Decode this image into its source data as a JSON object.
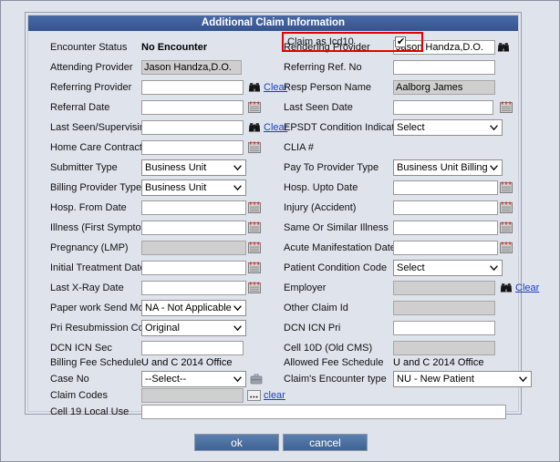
{
  "panel": {
    "title": "Additional Claim Information"
  },
  "icd10": {
    "label": "Claim as Icd10",
    "checked": true,
    "tick": "✔",
    "highlight_color": "#e60000"
  },
  "icons": {
    "binoculars": "binoculars-icon",
    "calendar": "calendar-icon",
    "briefcase": "briefcase-icon",
    "ellipsis": "ellipsis-button-icon"
  },
  "links": {
    "clear_cap": "Clear",
    "clear_low": "clear"
  },
  "left": [
    {
      "label": "Encounter Status",
      "type": "static",
      "value": "No Encounter",
      "bold": true
    },
    {
      "label": "Attending Provider",
      "type": "readonly",
      "value": "Jason Handza,D.O."
    },
    {
      "label": "Referring Provider",
      "type": "input",
      "value": "",
      "icon": "binoculars",
      "link": "Clear"
    },
    {
      "label": "Referral Date",
      "type": "input",
      "value": "",
      "icon": "calendar"
    },
    {
      "label": "Last Seen/Supervising Doc",
      "type": "input",
      "value": "",
      "icon": "binoculars",
      "link": "Clear"
    },
    {
      "label": "Home Care Contract Date",
      "type": "input",
      "value": "",
      "icon": "calendar"
    },
    {
      "label": "Submitter Type",
      "type": "select",
      "value": "Business Unit"
    },
    {
      "label": "Billing Provider Type",
      "type": "select",
      "value": "Business Unit"
    },
    {
      "label": "Hosp. From Date",
      "type": "input",
      "value": "",
      "icon": "calendar"
    },
    {
      "label": "Illness (First Symptom)",
      "type": "input",
      "value": "",
      "icon": "calendar"
    },
    {
      "label": "Pregnancy (LMP)",
      "type": "readonly",
      "value": "",
      "icon": "calendar"
    },
    {
      "label": "Initial Treatment Date",
      "type": "input",
      "value": "",
      "icon": "calendar"
    },
    {
      "label": "Last X-Ray Date",
      "type": "input",
      "value": "",
      "icon": "calendar"
    },
    {
      "label": "Paper work Send Mode",
      "type": "select",
      "value": "NA - Not Applicable"
    },
    {
      "label": "Pri Resubmission Code",
      "type": "select",
      "value": "Original"
    },
    {
      "label": "DCN ICN Sec",
      "type": "input",
      "value": ""
    },
    {
      "label": "Billing Fee Schedule",
      "type": "static",
      "value": "U and C 2014 Office",
      "bold": false
    },
    {
      "label": "Case No",
      "type": "select",
      "value": "--Select--",
      "icon": "briefcase"
    },
    {
      "label": "Claim Codes",
      "type": "readonly",
      "value": "",
      "icon": "ellipsis",
      "link": "clear"
    },
    {
      "label": "Cell 19 Local Use",
      "type": "input",
      "value": ""
    }
  ],
  "right": [
    {
      "label": "Rendering Provider",
      "type": "input",
      "value": "Jason Handza,D.O.",
      "icon": "binoculars"
    },
    {
      "label": "Referring Ref. No",
      "type": "input",
      "value": ""
    },
    {
      "label": "Resp Person Name",
      "type": "readonly",
      "value": "Aalborg James"
    },
    {
      "label": "Last Seen Date",
      "type": "input",
      "value": "",
      "icon": "calendar"
    },
    {
      "label": "EPSDT Condition Indicator",
      "type": "select",
      "value": "Select"
    },
    {
      "label": "CLIA #",
      "type": "none",
      "value": ""
    },
    {
      "label": "Pay To Provider Type",
      "type": "select",
      "value": "Business Unit Billing"
    },
    {
      "label": "Hosp. Upto Date",
      "type": "input",
      "value": "",
      "icon": "calendar"
    },
    {
      "label": "Injury (Accident)",
      "type": "input",
      "value": "",
      "icon": "calendar"
    },
    {
      "label": "Same Or Similar Illness",
      "type": "input",
      "value": "",
      "icon": "calendar"
    },
    {
      "label": "Acute Manifestation Date",
      "type": "input",
      "value": "",
      "icon": "calendar"
    },
    {
      "label": "Patient Condition Code",
      "type": "select",
      "value": "Select"
    },
    {
      "label": "Employer",
      "type": "readonly",
      "value": "",
      "icon": "binoculars",
      "link": "Clear"
    },
    {
      "label": "Other Claim Id",
      "type": "readonly",
      "value": ""
    },
    {
      "label": "DCN ICN Pri",
      "type": "input",
      "value": ""
    },
    {
      "label": "Cell 10D (Old CMS)",
      "type": "readonly",
      "value": ""
    },
    {
      "label": "Allowed Fee Schedule",
      "type": "static",
      "value": "U and C 2014 Office",
      "bold": false
    },
    {
      "label": "Claim's Encounter type",
      "type": "select",
      "value": "NU - New Patient"
    }
  ],
  "buttons": {
    "ok": "ok",
    "cancel": "cancel"
  }
}
